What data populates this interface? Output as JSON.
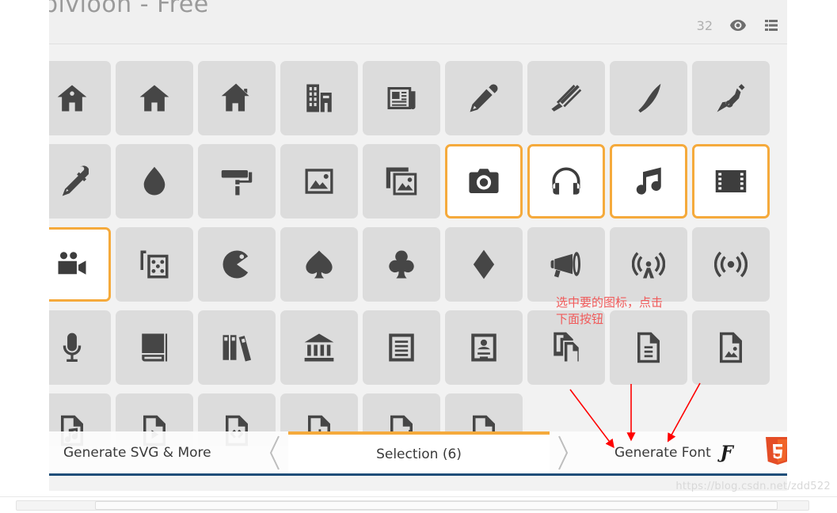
{
  "window": {
    "title": "bivioon - Free",
    "header": {
      "count": "32",
      "eye_icon": "eye-icon",
      "menu_icon": "list-menu-icon"
    }
  },
  "grid": {
    "columns": 9,
    "rows": 5,
    "partial_left_column": true,
    "icons": [
      {
        "name": "home-outline-icon",
        "selected": false,
        "partial": true
      },
      {
        "name": "home-icon",
        "selected": false
      },
      {
        "name": "home-solid-icon",
        "selected": false
      },
      {
        "name": "building-icon",
        "selected": false
      },
      {
        "name": "newspaper-icon",
        "selected": false
      },
      {
        "name": "pencil-icon",
        "selected": false
      },
      {
        "name": "pen-stroke-icon",
        "selected": false
      },
      {
        "name": "feather-icon",
        "selected": false
      },
      {
        "name": "pen-nib-icon",
        "selected": false
      },
      {
        "name": "eyedropper-partial-icon",
        "selected": false,
        "partial": true
      },
      {
        "name": "eyedropper-icon",
        "selected": false
      },
      {
        "name": "droplet-icon",
        "selected": false
      },
      {
        "name": "paint-roller-icon",
        "selected": false
      },
      {
        "name": "image-icon",
        "selected": false
      },
      {
        "name": "images-icon",
        "selected": false
      },
      {
        "name": "camera-icon",
        "selected": true
      },
      {
        "name": "headphones-icon",
        "selected": true
      },
      {
        "name": "music-note-icon",
        "selected": true
      },
      {
        "name": "film-partial-icon",
        "selected": true,
        "partial": true
      },
      {
        "name": "film-icon",
        "selected": true
      },
      {
        "name": "video-camera-icon",
        "selected": true
      },
      {
        "name": "dice-icon",
        "selected": false
      },
      {
        "name": "pacman-icon",
        "selected": false
      },
      {
        "name": "spade-icon",
        "selected": false
      },
      {
        "name": "club-icon",
        "selected": false
      },
      {
        "name": "diamond-icon",
        "selected": false
      },
      {
        "name": "megaphone-icon",
        "selected": false
      },
      {
        "name": "broadcast-partial-icon",
        "selected": false,
        "partial": true
      },
      {
        "name": "broadcast-tower-icon",
        "selected": false
      },
      {
        "name": "signal-waves-icon",
        "selected": false
      },
      {
        "name": "microphone-icon",
        "selected": false
      },
      {
        "name": "book-icon",
        "selected": false
      },
      {
        "name": "books-icon",
        "selected": false
      },
      {
        "name": "bank-icon",
        "selected": false
      },
      {
        "name": "document-text-icon",
        "selected": false
      },
      {
        "name": "id-card-icon",
        "selected": false
      },
      {
        "name": "file-copy-partial-icon",
        "selected": false,
        "partial": true
      },
      {
        "name": "file-copy-icon",
        "selected": false
      },
      {
        "name": "file-lines-icon",
        "selected": false
      },
      {
        "name": "file-image-icon",
        "selected": false
      },
      {
        "name": "file-music-icon",
        "selected": false
      },
      {
        "name": "file-video-icon",
        "selected": false
      },
      {
        "name": "file-code-icon",
        "selected": false
      },
      {
        "name": "file-data-icon",
        "selected": false
      },
      {
        "name": "file-add-icon",
        "selected": false
      }
    ]
  },
  "bottom_bar": {
    "generate_svg_label": "Generate SVG & More",
    "prev_chevron": "chevron-left-icon",
    "selection_label": "Selection (6)",
    "next_chevron": "chevron-right-icon",
    "generate_font_label": "Generate Font",
    "font_glyph": "Ƒ",
    "html5_logo": "html5-logo-icon",
    "accent_color": "#f5aa3c"
  },
  "annotation": {
    "text": "选中要的图标，点击\n下面按钮",
    "color": "#f05a5a",
    "arrows": 3
  },
  "watermark": {
    "text": "https://blog.csdn.net/zdd522"
  }
}
